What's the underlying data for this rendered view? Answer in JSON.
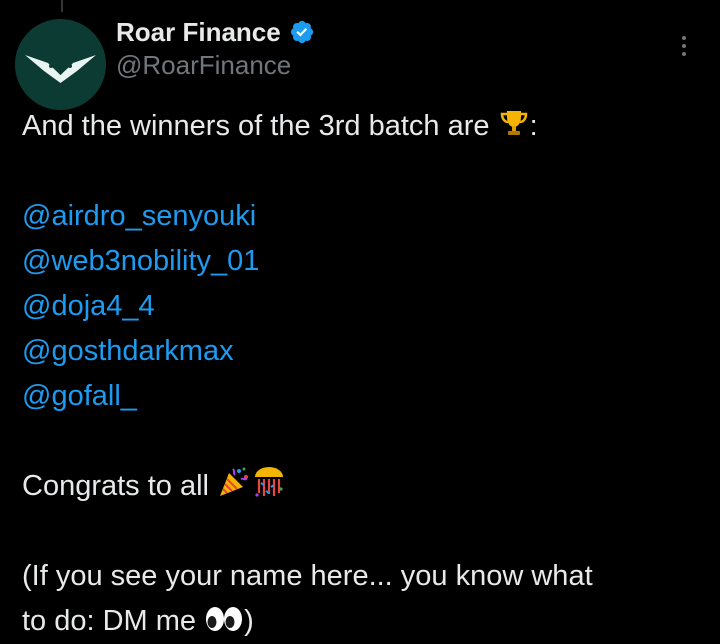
{
  "author": {
    "display_name": "Roar Finance",
    "handle": "@RoarFinance",
    "verified": true,
    "avatar_icon": "roar-logo-icon"
  },
  "tweet": {
    "intro_text": "And the winners of the 3rd batch are ",
    "intro_suffix": ":",
    "intro_emoji": "trophy-emoji",
    "mentions": [
      "@airdro_senyouki",
      "@web3nobility_01",
      "@doja4_4",
      "@gosthdarkmax",
      "@gofall_"
    ],
    "congrats_text": "Congrats to all ",
    "congrats_emojis": [
      "party-popper-emoji",
      "confetti-ball-emoji"
    ],
    "closing_line_1": "(If you see your name here... you know what",
    "closing_line_2_text": "to do: DM me ",
    "closing_line_2_suffix": ")",
    "closing_emoji": "eyes-emoji"
  },
  "colors": {
    "background": "#000000",
    "text": "#e7e9ea",
    "secondary_text": "#71767b",
    "link": "#1d9bf0",
    "verified_badge": "#1d9bf0"
  }
}
